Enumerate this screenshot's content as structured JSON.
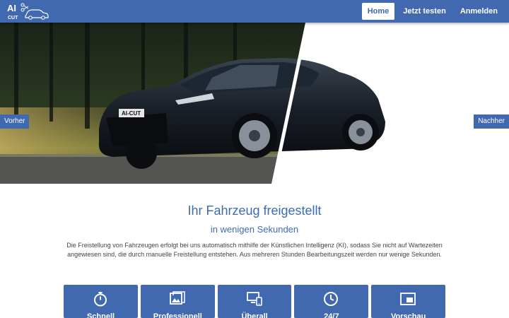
{
  "brand": {
    "logo_line1": "AI",
    "logo_line2": "CUT"
  },
  "nav": {
    "items": [
      {
        "label": "Home",
        "active": true
      },
      {
        "label": "Jetzt testen",
        "active": false
      },
      {
        "label": "Anmelden",
        "active": false
      }
    ]
  },
  "hero": {
    "before_label": "Vorher",
    "after_label": "Nachher",
    "plate_text": "AI-CUT"
  },
  "main": {
    "title": "Ihr Fahrzeug freigestellt",
    "subtitle": "in wenigen Sekunden",
    "description": "Die Freistellung von Fahrzeugen erfolgt bei uns automatisch mithilfe der Künstlichen Intelligenz (KI), sodass Sie nicht auf Wartezeiten angewiesen sind, die durch manuelle Freistellung entstehen. Aus mehreren Stunden Bearbeitungszeit werden nur wenige Sekunden."
  },
  "features": [
    {
      "label": "Schnell",
      "icon": "stopwatch-icon"
    },
    {
      "label": "Professionell",
      "icon": "image-icon"
    },
    {
      "label": "Überall",
      "icon": "devices-icon"
    },
    {
      "label": "24/7",
      "icon": "clock-icon"
    },
    {
      "label": "Vorschau",
      "icon": "preview-icon"
    }
  ],
  "colors": {
    "primary": "#4169b0",
    "heading": "#3e6bb0"
  }
}
